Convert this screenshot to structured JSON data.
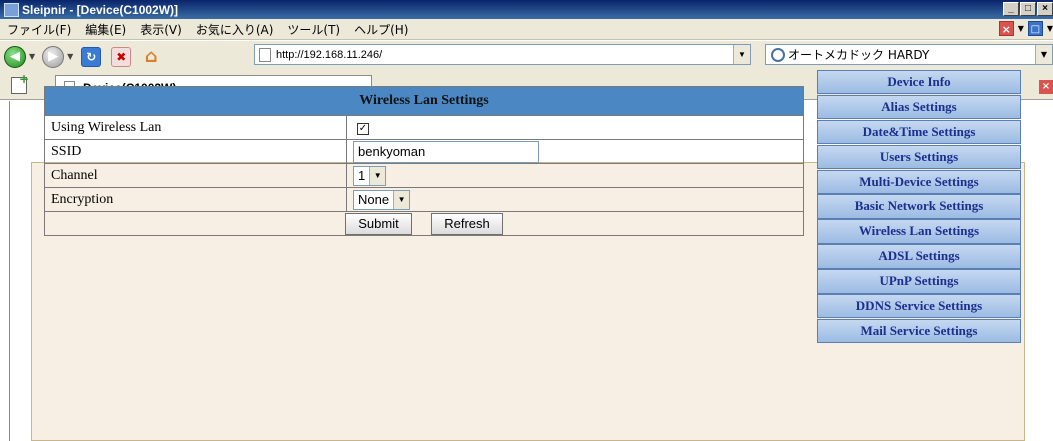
{
  "window": {
    "title": "Sleipnir - [Device(C1002W)]",
    "controls": [
      "_",
      "□",
      "×"
    ]
  },
  "menu": {
    "items": [
      "ファイル(F)",
      "編集(E)",
      "表示(V)",
      "お気に入り(A)",
      "ツール(T)",
      "ヘルプ(H)"
    ]
  },
  "toolbar": {
    "address": "http://192.168.11.246/",
    "search_text": "オートメカドック HARDY"
  },
  "tab": {
    "title": "Device(C1002W)"
  },
  "form": {
    "header": "Wireless Lan Settings",
    "rows": [
      {
        "label": "Using Wireless Lan",
        "checked": true
      },
      {
        "label": "SSID",
        "value": "benkyoman"
      },
      {
        "label": "Channel",
        "value": "1"
      },
      {
        "label": "Encryption",
        "value": "None"
      }
    ],
    "submit": "Submit",
    "refresh": "Refresh"
  },
  "sidebar": {
    "items": [
      "Device Info",
      "Alias Settings",
      "Date&Time Settings",
      "Users Settings",
      "Multi-Device Settings",
      "Basic Network Settings",
      "Wireless Lan Settings",
      "ADSL Settings",
      "UPnP Settings",
      "DDNS Service Settings",
      "Mail Service Settings"
    ]
  }
}
